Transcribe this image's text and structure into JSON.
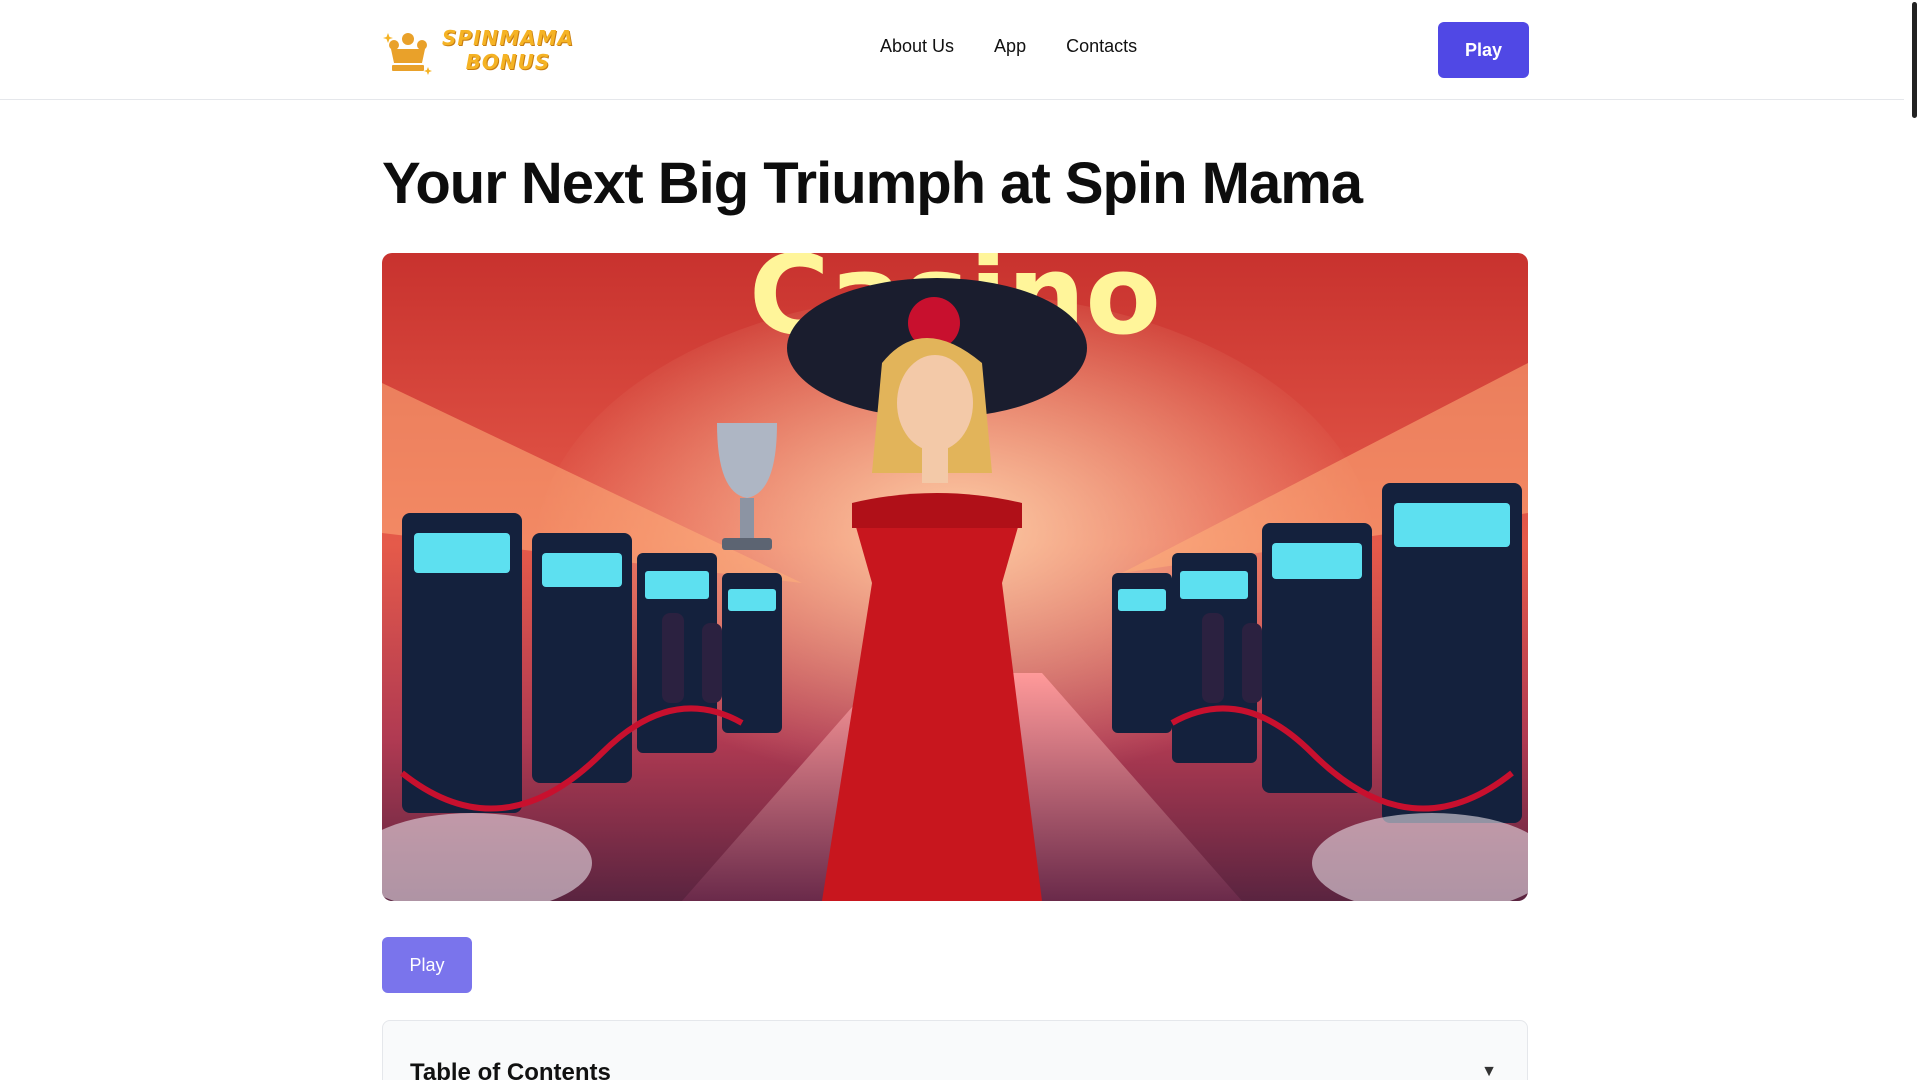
{
  "header": {
    "logo_text_line1": "SPINMAMA",
    "logo_text_line2": "BONUS",
    "nav": [
      "About Us",
      "App",
      "Contacts"
    ],
    "play_label": "Play"
  },
  "main": {
    "title": "Your Next Big Triumph at Spin Mama",
    "hero_sign": "Casino",
    "play_label": "Play",
    "toc_title": "Table of Contents",
    "toc_toggle_icon": "▼"
  },
  "colors": {
    "accent": "#5048e5",
    "accent_light": "#7a74ec",
    "logo": "#f5b324"
  }
}
